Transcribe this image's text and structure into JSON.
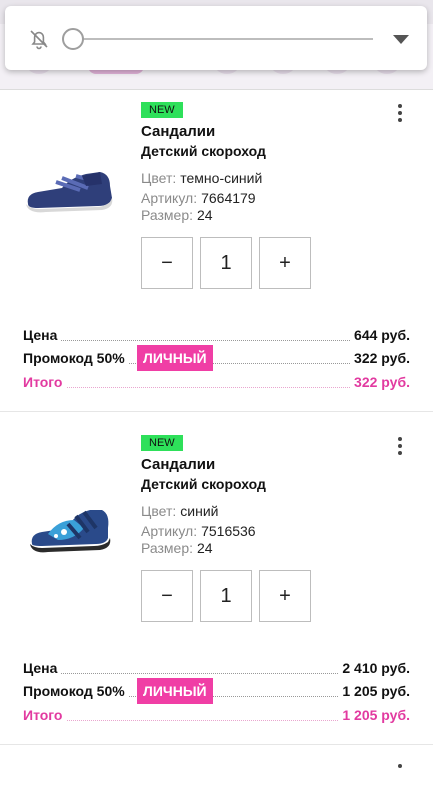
{
  "colors": {
    "accent": "#e23aa0",
    "badge_new": "#2ee05a",
    "chip": "#f03ea5"
  },
  "icons": {
    "notification": "bell-off-icon",
    "expand": "chevron-down-icon",
    "more": "more-vert-icon"
  },
  "cart_items": [
    {
      "badge": "NEW",
      "title": "Сандалии",
      "brand": "Детский скороход",
      "color_label": "Цвет:",
      "color_value": "темно-синий",
      "sku_label": "Артикул:",
      "sku_value": "7664179",
      "size_label": "Размер:",
      "size_value": "24",
      "qty_minus": "−",
      "qty_value": "1",
      "qty_plus": "+",
      "price_label": "Цена",
      "price_value": "644 руб.",
      "promo_label": "Промокод 50%",
      "promo_chip": "ЛИЧНЫЙ",
      "promo_value": "322 руб.",
      "total_label": "Итого",
      "total_value": "322 руб."
    },
    {
      "badge": "NEW",
      "title": "Сандалии",
      "brand": "Детский скороход",
      "color_label": "Цвет:",
      "color_value": "синий",
      "sku_label": "Артикул:",
      "sku_value": "7516536",
      "size_label": "Размер:",
      "size_value": "24",
      "qty_minus": "−",
      "qty_value": "1",
      "qty_plus": "+",
      "price_label": "Цена",
      "price_value": "2 410 руб.",
      "promo_label": "Промокод 50%",
      "promo_chip": "ЛИЧНЫЙ",
      "promo_value": "1 205 руб.",
      "total_label": "Итого",
      "total_value": "1 205 руб."
    }
  ]
}
